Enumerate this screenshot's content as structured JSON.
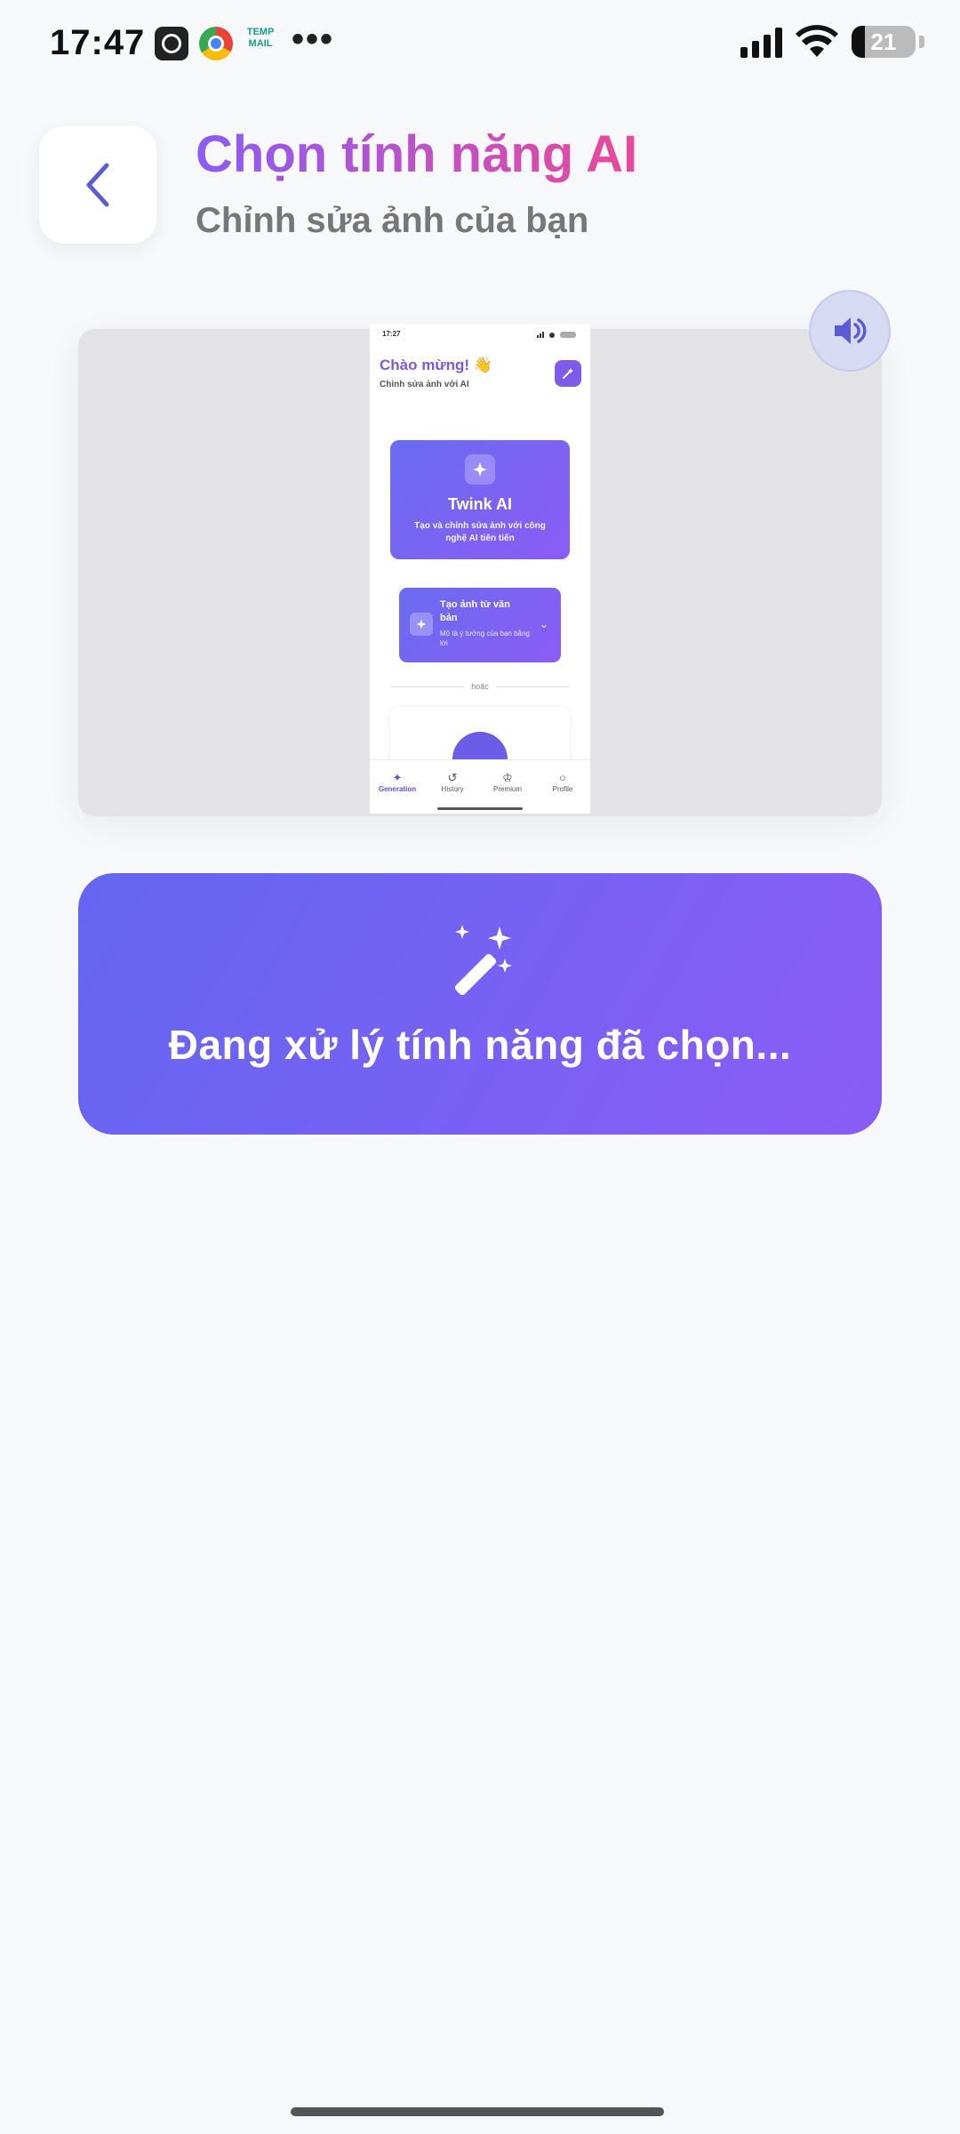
{
  "status_bar": {
    "time": "17:47",
    "temp_app_label": "TEMP MAIL",
    "more": "•••",
    "battery": "21",
    "battery_level": 0.21
  },
  "header": {
    "title": "Chọn tính năng AI",
    "subtitle": "Chỉnh sửa ảnh của bạn"
  },
  "preview": {
    "status_time": "17:27",
    "greeting": "Chào mừng! 👋",
    "greeting_sub": "Chỉnh sửa ảnh với AI",
    "card_title": "Twink AI",
    "card_desc": "Tạo và chỉnh sửa ảnh với công nghệ AI tiên tiến",
    "option_title": "Tạo ảnh từ văn bản",
    "option_desc": "Mô tả ý tưởng của bạn bằng lời",
    "divider": "hoặc",
    "nav": [
      "Generation",
      "History",
      "Premium",
      "Profile"
    ]
  },
  "processing": {
    "text": "Đang xử lý tính năng đã chọn..."
  },
  "colors": {
    "accent": "#8b5cf6",
    "accent_start": "#6366f1",
    "title_gradient_end": "#ec4899"
  }
}
